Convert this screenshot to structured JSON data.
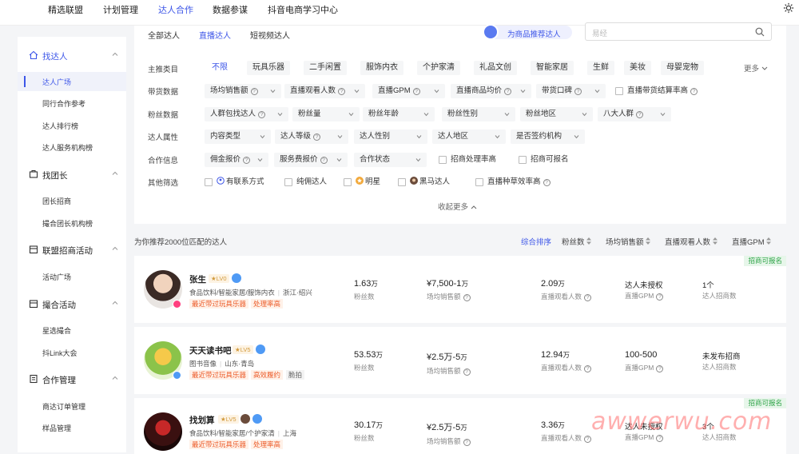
{
  "topnav": {
    "items": [
      "精选联盟",
      "计划管理",
      "达人合作",
      "数据参谋",
      "抖音电商学习中心"
    ],
    "active_index": 2,
    "icons": [
      "gear-icon"
    ]
  },
  "sidebar": {
    "sections": [
      {
        "label": "找达人",
        "icon": "home-icon",
        "items": [
          "达人广场",
          "同行合作参考",
          "达人排行榜",
          "达人服务机构榜"
        ],
        "active_item": 0
      },
      {
        "label": "找团长",
        "icon": "group-icon",
        "items": [
          "团长招商",
          "撮合团长机构榜"
        ]
      },
      {
        "label": "联盟招商活动",
        "icon": "calendar-icon",
        "items": [
          "活动广场"
        ]
      },
      {
        "label": "撮合活动",
        "icon": "calendar-icon",
        "items": [
          "星选撮合",
          "抖Link大会"
        ]
      },
      {
        "label": "合作管理",
        "icon": "document-icon",
        "items": [
          "商达订单管理",
          "样品管理"
        ]
      }
    ]
  },
  "filter": {
    "tabs": [
      "全部达人",
      "直播达人",
      "短视频达人"
    ],
    "active_tab": 1,
    "recommend_button": "为商品推荐达人",
    "search_placeholder": "易经",
    "rows": {
      "category_label": "主推类目",
      "categories": [
        "不限",
        "玩具乐器",
        "二手闲置",
        "服饰内衣",
        "个护家清",
        "礼品文创",
        "智能家居",
        "生鲜",
        "美妆",
        "母婴宠物"
      ],
      "more": "更多",
      "sales_label": "带货数据",
      "sales": [
        "场均销售额",
        "直播观看人数",
        "直播GPM",
        "直播商品均价",
        "带货口碑"
      ],
      "sales_checkbox": "直播带货结算率高",
      "fans_label": "粉丝数据",
      "fans": [
        "人群包找达人",
        "粉丝量",
        "粉丝年龄",
        "粉丝性别",
        "粉丝地区",
        "八大人群"
      ],
      "attr_label": "达人属性",
      "attrs": [
        "内容类型",
        "达人等级",
        "达人性别",
        "达人地区",
        "是否签约机构"
      ],
      "coop_label": "合作信息",
      "coop": [
        "佣金报价",
        "服务费报价",
        "合作状态"
      ],
      "coop_checkboxes": [
        "招商处理率高",
        "招商可报名"
      ],
      "other_label": "其他筛选",
      "others": [
        "有联系方式",
        "纯佣达人",
        "明星",
        "黑马达人",
        "直播种草效率高"
      ]
    },
    "collapse": "收起更多"
  },
  "list": {
    "summary": "为你推荐2000位匹配的达人",
    "sorts": [
      "综合排序",
      "粉丝数",
      "场均销售额",
      "直播观看人数",
      "直播GPM"
    ],
    "active_sort": 0
  },
  "creators": [
    {
      "name": "张生",
      "level": "LV0",
      "tags": [
        "食品饮料/智能家居/服饰内衣",
        "浙江·绍兴"
      ],
      "pills": [
        "最近带过玩具乐器",
        "处理率高"
      ],
      "fans": "1.63",
      "fans_unit": "万",
      "fans_label": "粉丝数",
      "sales": "¥7,500-1",
      "sales_unit": "万",
      "sales_label": "场均销售额",
      "viewers": "2.09",
      "viewers_unit": "万",
      "viewers_label": "直播观看人数",
      "gpm": "达人未授权",
      "gpm_label": "直播GPM",
      "rec": "1个",
      "rec_label": "达人招商数",
      "badge": "招商可报名"
    },
    {
      "name": "天天读书吧",
      "level": "LV5",
      "tags": [
        "图书音像",
        "山东·青岛"
      ],
      "pills": [
        "最近带过玩具乐器",
        "高效履约",
        "脆拍"
      ],
      "fans": "53.53",
      "fans_unit": "万",
      "fans_label": "粉丝数",
      "sales": "¥2.5万-5",
      "sales_unit": "万",
      "sales_label": "场均销售额",
      "viewers": "12.94",
      "viewers_unit": "万",
      "viewers_label": "直播观看人数",
      "gpm": "100-500",
      "gpm_label": "直播GPM",
      "rec": "未发布招商",
      "rec_label": "达人招商数",
      "badge": ""
    },
    {
      "name": "找划算",
      "level": "LV5",
      "tags": [
        "食品饮料/智能家居/个护家清",
        "上海"
      ],
      "pills": [
        "最近带过玩具乐器",
        "处理率高"
      ],
      "fans": "30.17",
      "fans_unit": "万",
      "fans_label": "粉丝数",
      "sales": "¥2.5万-5",
      "sales_unit": "万",
      "sales_label": "场均销售额",
      "viewers": "3.36",
      "viewers_unit": "万",
      "viewers_label": "直播观看人数",
      "gpm": "达人未授权",
      "gpm_label": "直播GPM",
      "rec": "3个",
      "rec_label": "达人招商数",
      "badge": "招商可报名"
    }
  ],
  "watermark": "awwerwu.com",
  "colors": {
    "accent": "#3d56e8",
    "orange": "#ec5d2b",
    "green": "#2ba245"
  }
}
